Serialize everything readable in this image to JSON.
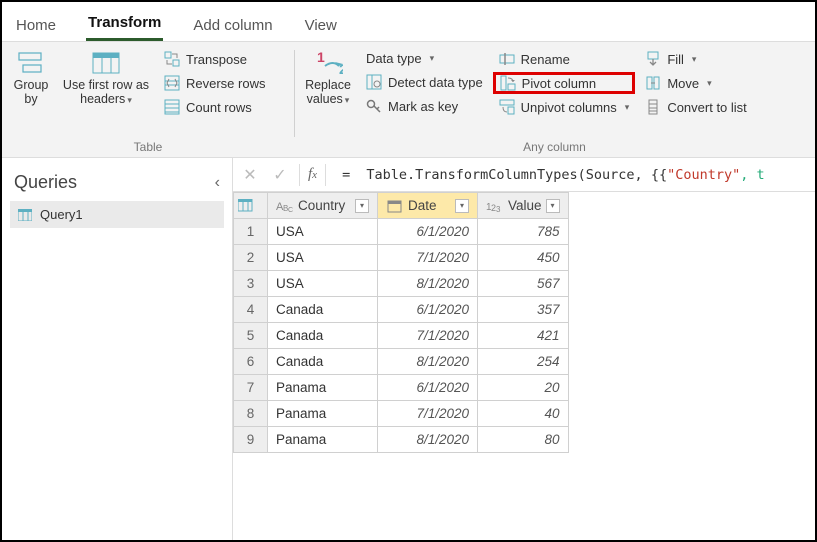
{
  "tabs": {
    "home": "Home",
    "transform": "Transform",
    "addcol": "Add column",
    "view": "View"
  },
  "ribbon": {
    "table": {
      "groupby": "Group\nby",
      "useheaders": "Use first row as\nheaders",
      "transpose": "Transpose",
      "reverse": "Reverse rows",
      "count": "Count rows",
      "label": "Table"
    },
    "anycol": {
      "replace": "Replace\nvalues",
      "datatype": "Data type",
      "detect": "Detect data type",
      "markkey": "Mark as key",
      "rename": "Rename",
      "pivot": "Pivot column",
      "unpivot": "Unpivot columns",
      "fill": "Fill",
      "move": "Move",
      "convert": "Convert to list",
      "label": "Any column"
    }
  },
  "queries": {
    "title": "Queries",
    "item1": "Query1"
  },
  "formula": {
    "prefix": "Table.TransformColumnTypes(Source, {{",
    "str": "\"Country\"",
    "suffix": ", t"
  },
  "columns": {
    "country": "Country",
    "date": "Date",
    "value": "Value"
  },
  "rows": [
    {
      "n": "1",
      "country": "USA",
      "date": "6/1/2020",
      "value": "785"
    },
    {
      "n": "2",
      "country": "USA",
      "date": "7/1/2020",
      "value": "450"
    },
    {
      "n": "3",
      "country": "USA",
      "date": "8/1/2020",
      "value": "567"
    },
    {
      "n": "4",
      "country": "Canada",
      "date": "6/1/2020",
      "value": "357"
    },
    {
      "n": "5",
      "country": "Canada",
      "date": "7/1/2020",
      "value": "421"
    },
    {
      "n": "6",
      "country": "Canada",
      "date": "8/1/2020",
      "value": "254"
    },
    {
      "n": "7",
      "country": "Panama",
      "date": "6/1/2020",
      "value": "20"
    },
    {
      "n": "8",
      "country": "Panama",
      "date": "7/1/2020",
      "value": "40"
    },
    {
      "n": "9",
      "country": "Panama",
      "date": "8/1/2020",
      "value": "80"
    }
  ]
}
